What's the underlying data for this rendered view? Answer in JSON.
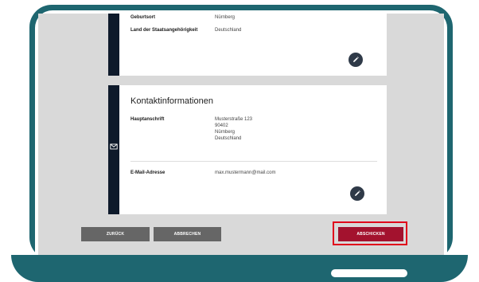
{
  "personal": {
    "birthplace_label": "Geburtsort",
    "birthplace_value": "Nürnberg",
    "citizenship_label": "Land der Staatsangehörigkeit",
    "citizenship_value": "Deutschland"
  },
  "contact": {
    "title": "Kontaktinformationen",
    "address_label": "Hauptanschrift",
    "address_lines": [
      "Musterstraße 123",
      "90402",
      "Nürnberg",
      "Deutschland"
    ],
    "email_label": "E-Mail-Adresse",
    "email_value": "max.mustermann@mail.com"
  },
  "buttons": {
    "back": "ZURÜCK",
    "cancel": "ABBRECHEN",
    "submit": "ABSCHICKEN"
  },
  "colors": {
    "frame": "#1e6670",
    "submit": "#a3122e",
    "secondary": "#666666",
    "highlight": "#e0001b"
  }
}
